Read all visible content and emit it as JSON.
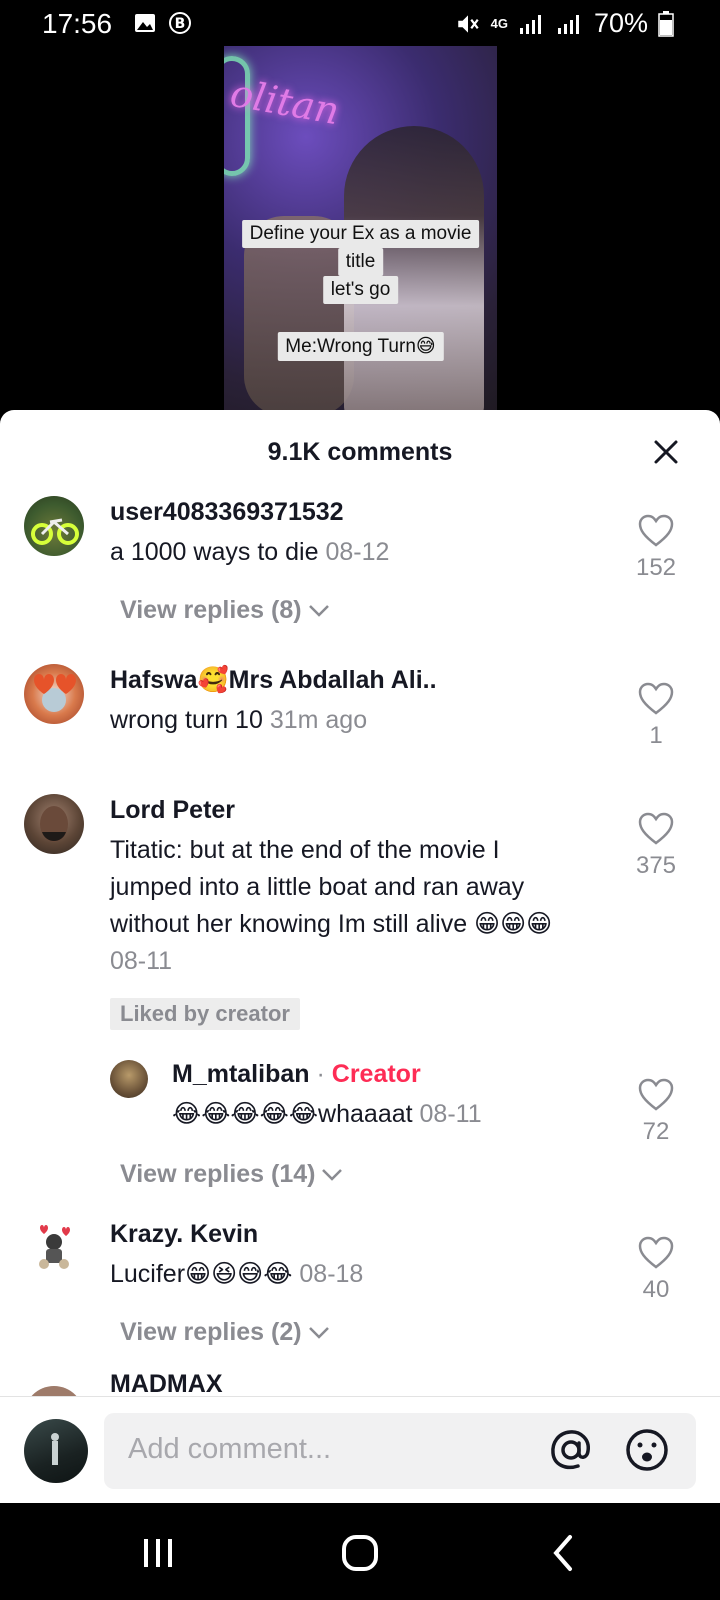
{
  "status_bar": {
    "time": "17:56",
    "network": "4G",
    "battery": "70%"
  },
  "video": {
    "neon_text": "olitan",
    "captions": [
      "Define your Ex as a movie",
      "title",
      "let's go",
      "Me:Wrong Turn😅"
    ]
  },
  "sheet": {
    "title": "9.1K comments"
  },
  "comments": [
    {
      "username": "user4083369371532",
      "text": "a 1000 ways to die",
      "time": "08-12",
      "likes": "152",
      "view_replies": "View replies (8)"
    },
    {
      "username": "Hafswa🥰Mrs Abdallah Ali..",
      "text": "wrong turn 10",
      "time": "31m ago",
      "likes": "1"
    },
    {
      "username": "Lord Peter",
      "text_lines": [
        "Titatic: but at the end of the movie I",
        "jumped into a little boat and ran away",
        "without her knowing Im still alive 😁😁😁"
      ],
      "time": "08-11",
      "likes": "375",
      "liked_badge": "Liked by creator",
      "reply": {
        "username": "M_mtaliban",
        "separator": "·",
        "creator_label": "Creator",
        "text": "😂😂😂😂😂whaaaat",
        "time": "08-11",
        "likes": "72"
      },
      "view_replies": "View replies (14)"
    },
    {
      "username": "Krazy. Kevin",
      "text": "Lucifer😁😆😅😂",
      "time": "08-18",
      "likes": "40",
      "view_replies": "View replies (2)"
    },
    {
      "username": "MADMAX"
    }
  ],
  "input": {
    "placeholder": "Add comment..."
  },
  "colors": {
    "creator": "#fe2c55",
    "secondary_text": "#8a8b91",
    "primary_text": "#161823"
  }
}
